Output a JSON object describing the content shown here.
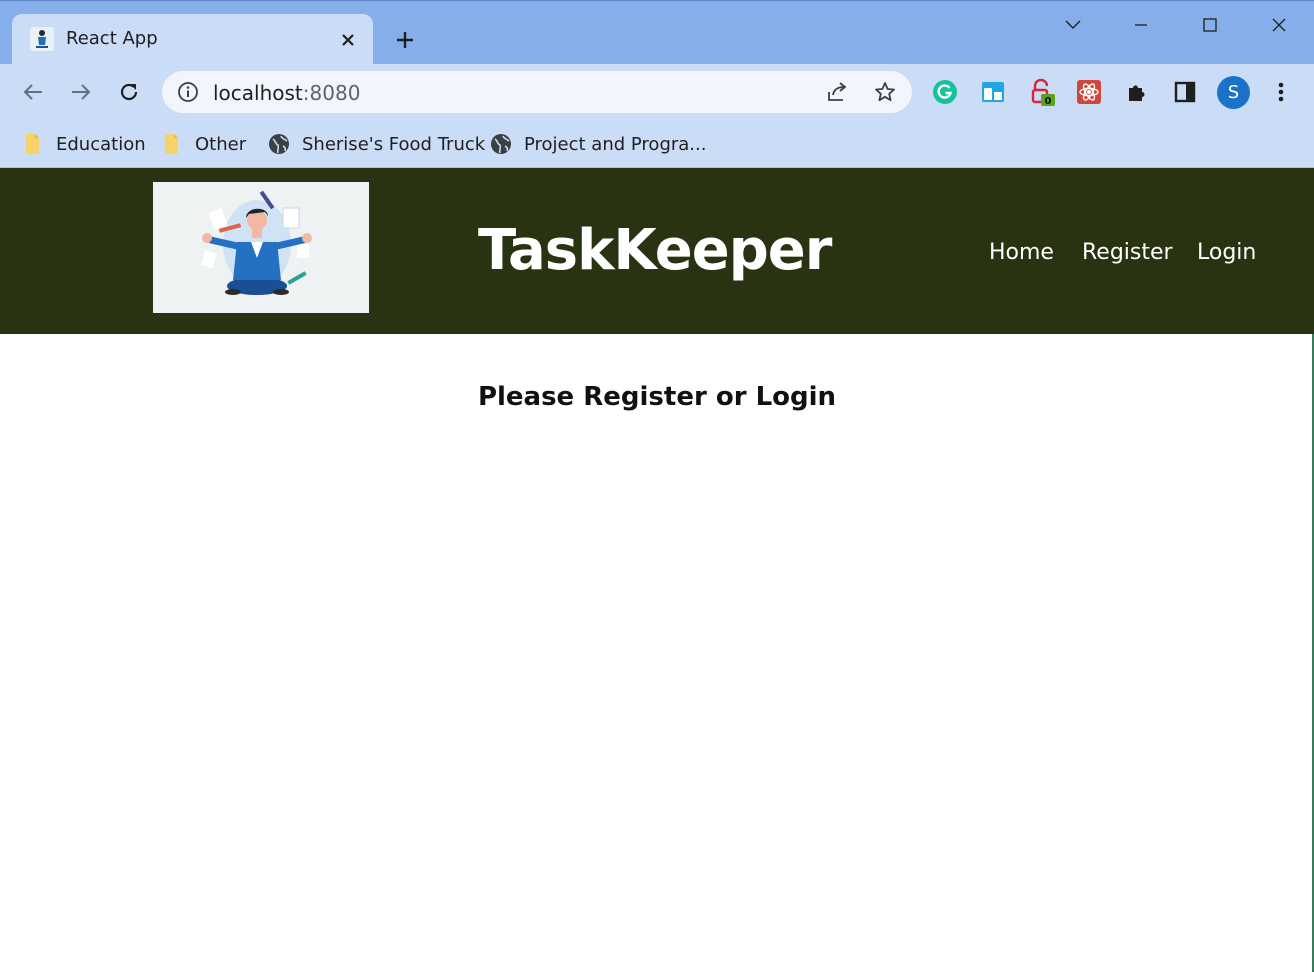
{
  "browser": {
    "tab": {
      "title": "React App",
      "favicon": "react-app-favicon"
    },
    "url": {
      "host": "localhost",
      "port": ":8080"
    },
    "bookmarks": [
      {
        "label": "Education",
        "icon": "folder-icon"
      },
      {
        "label": "Other",
        "icon": "folder-icon"
      },
      {
        "label": "Sherise's Food Truck",
        "icon": "globe-icon"
      },
      {
        "label": "Project and Progra...",
        "icon": "globe-icon"
      }
    ],
    "extensions": {
      "badge_count": "0"
    },
    "profile": {
      "initial": "S"
    },
    "colors": {
      "frame": "#86aeea",
      "toolbar": "#cbdcf7",
      "profile": "#1a73c9"
    }
  },
  "app": {
    "brand": "TaskKeeper",
    "nav": {
      "home": "Home",
      "register": "Register",
      "login": "Login"
    },
    "heading": "Please Register or Login",
    "colors": {
      "header_bg": "#283312",
      "header_text": "#ffffff"
    }
  }
}
